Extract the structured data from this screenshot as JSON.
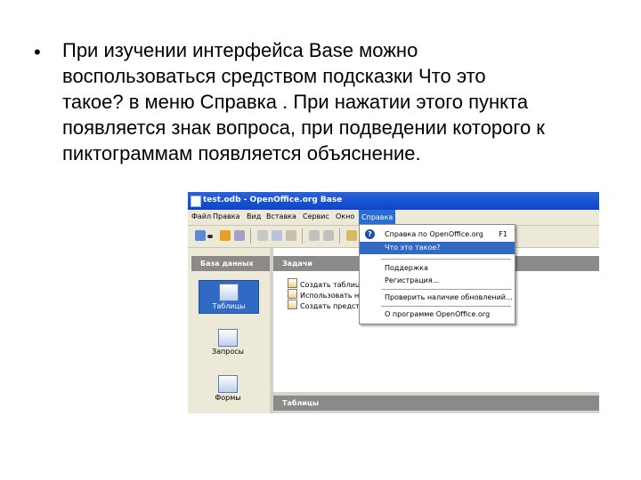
{
  "slide": {
    "bullet": "•",
    "lines": [
      "При изучении интерфейса Base можно",
      "воспользоваться средством подсказки  Что это",
      "такое? в меню Справка . При нажатии этого пункта",
      "появляется знак вопроса, при подведении которого к",
      "пиктограммам появляется объяснение."
    ]
  },
  "window": {
    "title": "test.odb - OpenOffice.org Base",
    "menu": [
      "Файл",
      "Правка",
      "Вид",
      "Вставка",
      "Сервис",
      "Окно",
      "Справка"
    ],
    "active_menu": "Справка",
    "left_pane": {
      "header": "База данных",
      "items": [
        "Таблицы",
        "Запросы",
        "Формы"
      ],
      "selected": "Таблицы"
    },
    "tasks": {
      "header": "Задачи",
      "items": [
        "Создать таблиц...",
        "Использовать на...",
        "Создать предст..."
      ]
    },
    "tables_header": "Таблицы",
    "help_menu": [
      {
        "label": "Справка по OpenOffice.org",
        "shortcut": "F1",
        "icon": "question-icon"
      },
      {
        "label": "Что это такое?",
        "shortcut": "",
        "highlighted": true
      },
      {
        "label": "Поддержка",
        "shortcut": ""
      },
      {
        "label": "Регистрация...",
        "shortcut": ""
      },
      {
        "label": "Проверить наличие обновлений...",
        "shortcut": ""
      },
      {
        "label": "О программе OpenOffice.org",
        "shortcut": ""
      }
    ]
  },
  "colors": {
    "titlebar": "#0c45c8",
    "highlight": "#316ac5",
    "pane_header": "#8b8a88",
    "chrome": "#ece9d8"
  }
}
